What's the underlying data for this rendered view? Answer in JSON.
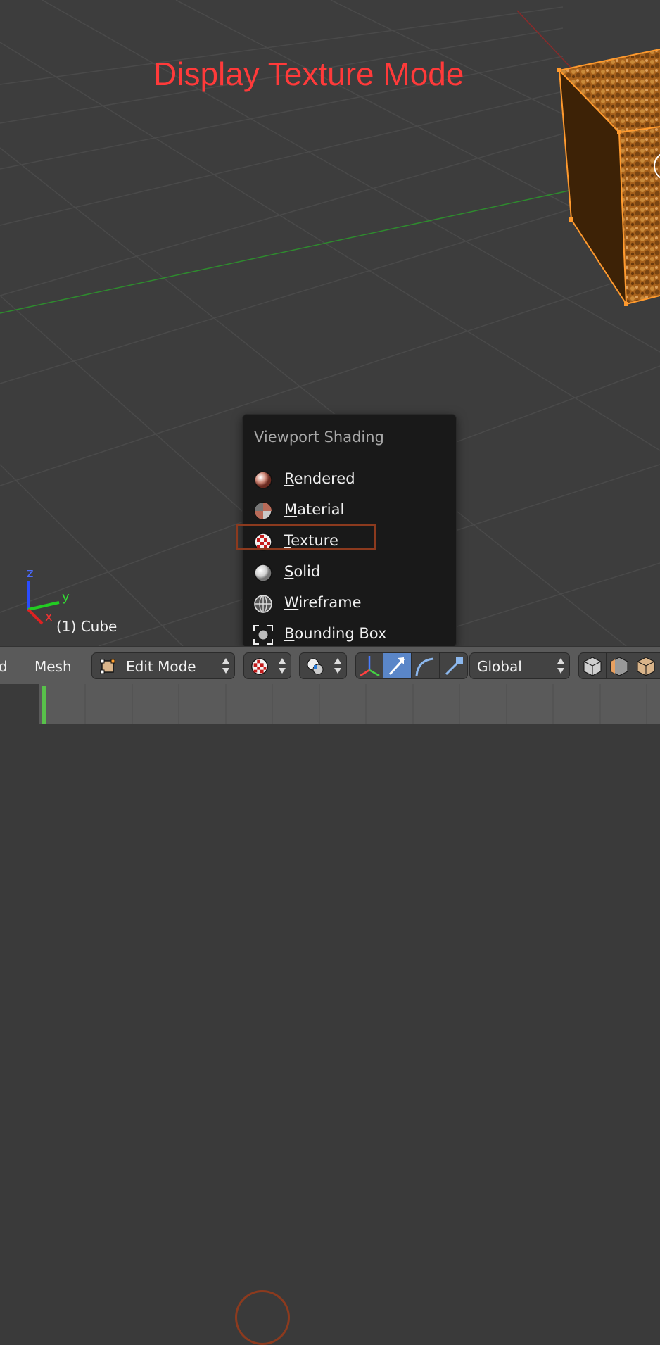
{
  "annotation": {
    "title": "Display Texture Mode",
    "color": "#ff3a3a",
    "highlight_color": "#8c3a1e"
  },
  "viewport": {
    "object_label": "(1) Cube",
    "axes": {
      "x": "x",
      "y": "y",
      "z": "z"
    }
  },
  "shading_menu": {
    "title": "Viewport Shading",
    "items": [
      {
        "label": "Rendered",
        "icon": "rendered-sphere-icon"
      },
      {
        "label": "Material",
        "icon": "material-sphere-icon"
      },
      {
        "label": "Texture",
        "icon": "texture-checker-icon",
        "selected": true
      },
      {
        "label": "Solid",
        "icon": "solid-sphere-icon"
      },
      {
        "label": "Wireframe",
        "icon": "wireframe-sphere-icon"
      },
      {
        "label": "Bounding Box",
        "icon": "bounding-box-icon"
      }
    ]
  },
  "header": {
    "menu_partial": "d",
    "mesh_menu": "Mesh",
    "mode": "Edit Mode",
    "shading_icon": "texture-checker-icon",
    "pivot_icon": "pivot-point-icon",
    "orientation": "Global",
    "manipulator_icons": [
      "manipulator-axes-icon",
      "translate-arrow-icon",
      "rotate-arc-icon",
      "scale-handle-icon"
    ],
    "layer_icons": [
      "cube-solid-icon",
      "cube-faces-icon",
      "cube-textured-icon"
    ]
  },
  "timeline": {
    "playhead_color": "#58c14a"
  }
}
